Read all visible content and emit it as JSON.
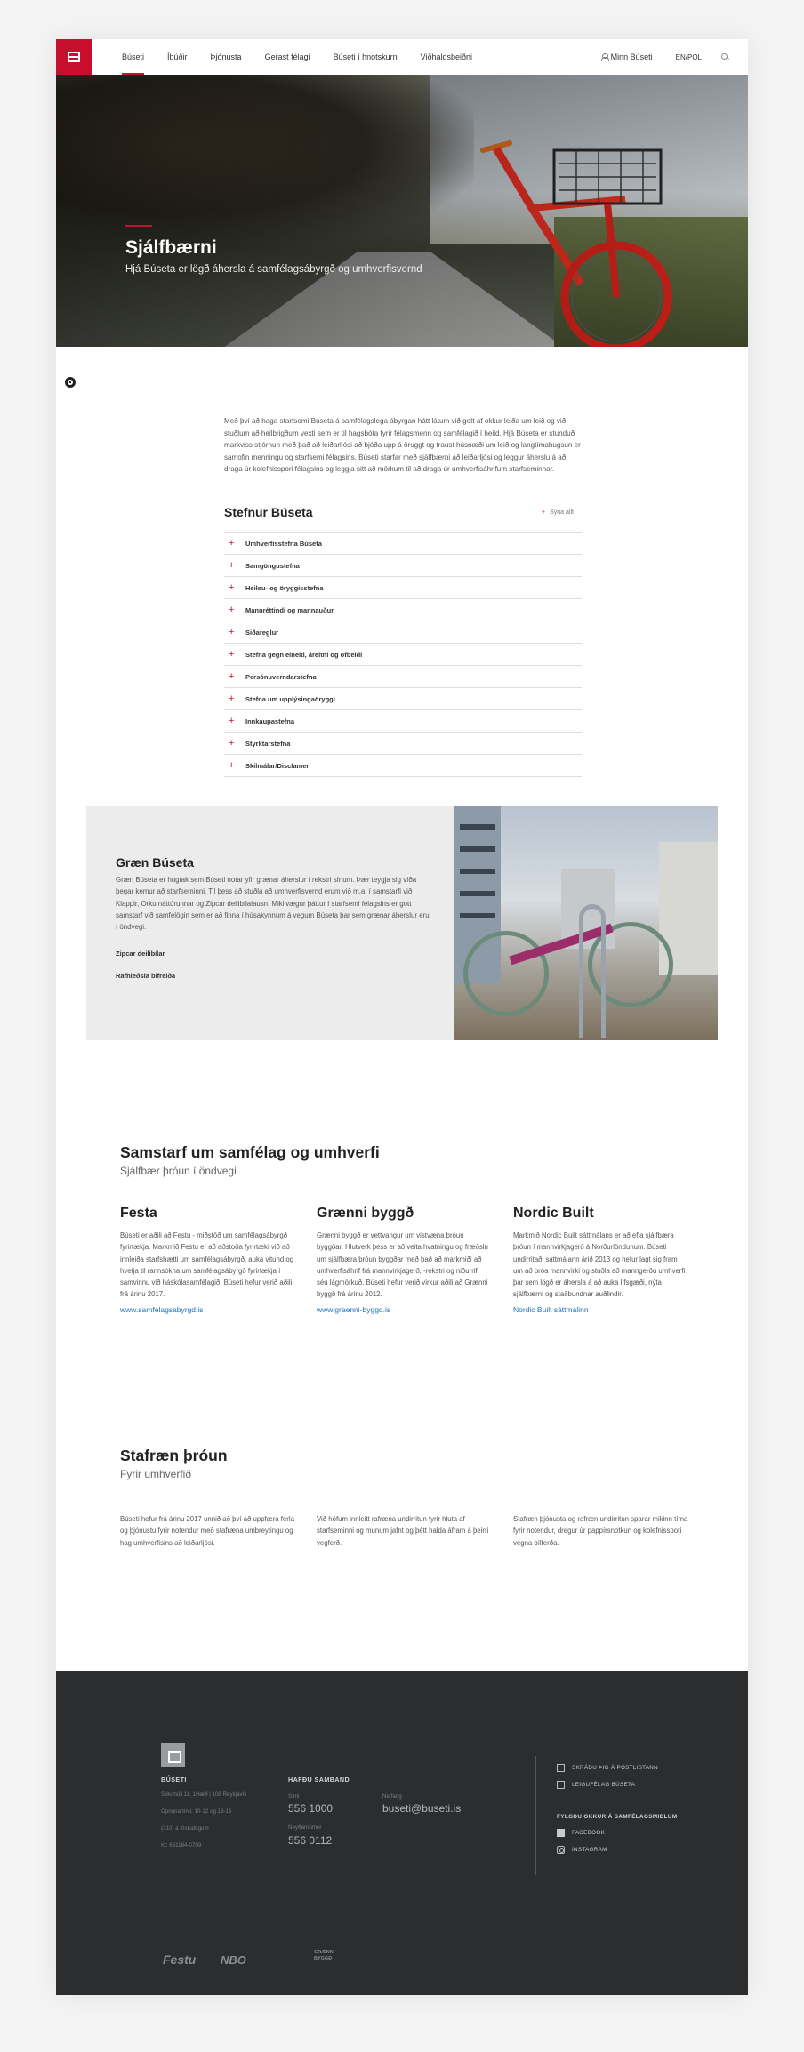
{
  "nav": {
    "items": [
      "Búseti",
      "Íbúðir",
      "Þjónusta",
      "Gerast félagi",
      "Búseti í hnotskurn",
      "Viðhaldsbeiðni"
    ],
    "minn_buseti": "Minn Búseti",
    "lang": "EN/POL"
  },
  "hero": {
    "title": "Sjálfbærni",
    "subtitle": "Hjá Búseta er lögð áhersla á samfélagsábyrgð og umhverfisvernd"
  },
  "intro": "Með því að haga starfsemi Búseta á samfélagslega ábyrgan hátt látum við gott af okkur leiða um leið og við stuðlum að heilbrigðum vexti sem er til hagsbóta fyrir félagsmenn og samfélagið í heild. Hjá Búseta er stunduð markviss stjórnun með það að leiðarljósi að bjóða upp á öruggt og traust húsnæði um leið og langtímahugsun er samofin menningu og starfsemi félagsins. Búseti starfar með sjálfbærni að leiðarljósi og leggur áherslu á að draga úr kolefnisspori félagsins og leggja sitt að mörkum til að draga úr umhverfisáhrifum starfseminnar.",
  "policies": {
    "title": "Stefnur Búseta",
    "show_all": "Sýna allt",
    "items": [
      "Umhverfisstefna Búseta",
      "Samgöngustefna",
      "Heilsu- og öryggisstefna",
      "Mannréttindi og mannauður",
      "Siðareglur",
      "Stefna gegn einelti, áreitni og ofbeldi",
      "Persónuverndarstefna",
      "Stefna um upplýsingaöryggi",
      "Innkaupastefna",
      "Styrktarstefna",
      "Skilmálar/Disclamer"
    ]
  },
  "green": {
    "title": "Græn Búseta",
    "text": "Græn Búseta er hugtak sem Búseti notar yfir grænar áherslur í rekstri sínum. Þær teygja sig víða þegar kemur að starfseminni. Til þess að stuðla að umhverfisvernd erum við m.a. í samstarfi við Klappir, Orku náttúrunnar og Zipcar deilibílalausn. Mikilvægur þáttur í starfsemi félagsins er gott samstarf við samfélögin sem er að finna í húsakynnum á vegum Búseta þar sem grænar áherslur eru í öndvegi.",
    "links": [
      "Zipcar deilibílar",
      "Rafhleðsla bifreiða"
    ]
  },
  "samstarf": {
    "title": "Samstarf um samfélag og umhverfi",
    "subtitle": "Sjálfbær þróun í öndvegi",
    "cols": [
      {
        "title": "Festa",
        "text": "Búseti er aðili að Festu - miðstöð um samfélagsábyrgð fyrirtækja. Markmið Festu er að aðstoða fyrirtæki við að innleiða starfshætti um samfélagsábyrgð, auka vitund og hvetja til rannsókna um samfélagsábyrgð fyrirtækja í samvinnu við háskólasamfélagið. Búseti hefur verið aðili frá árinu 2017.",
        "link": "www.samfelagsabyrgd.is"
      },
      {
        "title": "Grænni byggð",
        "text": "Grænni byggð er vettvangur um vistvæna þróun byggðar. Hlutverk þess er að veita hvatningu og fræðslu um sjálfbæra þróun byggðar með það að markmiði að umhverfisáhrif frá mannvirkjagerð, -rekstri og niðurrifi séu lágmörkuð. Búseti hefur verið virkur aðili að Grænni byggð frá árinu 2012.",
        "link": "www.graenni-byggd.is"
      },
      {
        "title": "Nordic Built",
        "text": "Markmið Nordic Built sáttmálans er að efla sjálfbæra þróun í mannvirkjagerð á Norðurlöndunum. Búseti undirritaði sáttmálann árið 2013 og hefur lagt sig fram um að þróa mannvirki og stuðla að manngerðu umhverfi þar sem lögð er áhersla á að auka lífsgæði, nýta sjálfbærni og staðbundnar auðlindir.",
        "link": "Nordic Built sáttmálinn"
      }
    ]
  },
  "stafraen": {
    "title": "Stafræn þróun",
    "subtitle": "Fyrir umhverfið",
    "cols": [
      "Búseti hefur frá árinu 2017 unnið að því að uppfæra ferla og þjónustu fyrir notendur með stafræna umbreytingu og hag umhverfisins að leiðarljósi.",
      "Við höfum innleitt rafræna undirritun fyrir hluta af starfseminni og munum jafnt og þétt halda áfram á þeirri vegferð.",
      "Stafræn þjónusta og rafræn undirritun sparar mikinn tíma fyrir notendur, dregur úr pappírsnotkun og kolefnisspori vegna bílferða."
    ]
  },
  "footer": {
    "company": "BÚSETI",
    "address": "Síðumúli 11, 1Hæð | 108 Reykjavík",
    "hours": "Opnunartími: 10-12 og 13-16",
    "bank": "(310) á föstudögum",
    "kt": "Kt: 661184-0709",
    "contact_head": "HAFÐU SAMBAND",
    "phone_label": "Sími",
    "phone": "556 1000",
    "emergency_label": "Neyðarnúmer",
    "emergency": "556 0112",
    "email_label": "Netfang",
    "email": "buseti@buseti.is",
    "links": [
      "SKRÁÐU ÞIG Á PÓSTLISTANN",
      "LEIGUFÉLAG BÚSETA"
    ],
    "social_head": "FYLGDU OKKUR Á SAMFÉLAGSMIÐLUM",
    "social": [
      "FACEBOOK",
      "INSTAGRAM"
    ],
    "partner_logos": [
      "Festu",
      "NBO",
      "GRÆNNI BYGGÐ"
    ]
  }
}
